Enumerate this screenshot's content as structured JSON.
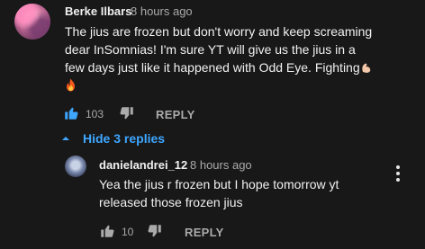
{
  "comment": {
    "author": "Berke Ilbars",
    "time": "8 hours ago",
    "text_lines": [
      "The jius are frozen but don't worry and keep screaming",
      "dear InSomnias! I'm sure YT will give us the jius in a",
      "few days just like it happened with Odd Eye. Fighting"
    ],
    "emojis": [
      "flexed-biceps",
      "fire"
    ],
    "likes": "103",
    "reply_label": "REPLY"
  },
  "replies_toggle": {
    "label": "Hide 3 replies"
  },
  "reply": {
    "author": "danielandrei_12",
    "time": "8 hours ago",
    "text_lines": [
      "Yea the jius r frozen but I hope tomorrow yt",
      "released those frozen jius"
    ],
    "likes": "10",
    "reply_label": "REPLY"
  },
  "colors": {
    "background": "#181818",
    "text_primary": "#f1f1f1",
    "text_secondary": "#aaaaaa",
    "link_blue": "#3ea6ff"
  }
}
